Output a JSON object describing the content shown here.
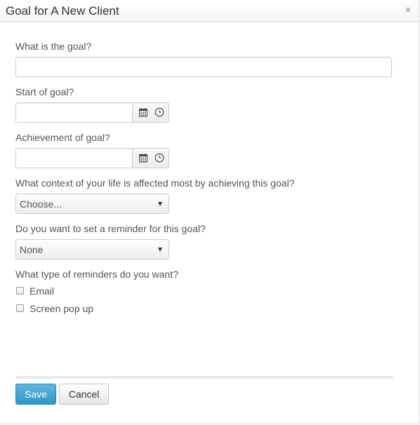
{
  "dialog": {
    "title": "Goal for A New Client"
  },
  "form": {
    "goal_label": "What is the goal?",
    "goal_value": "",
    "start_label": "Start of goal?",
    "start_value": "",
    "achievement_label": "Achievement of goal?",
    "achievement_value": "",
    "context_label": "What context of your life is affected most by achieving this goal?",
    "context_selected": "Choose...",
    "reminder_label": "Do you want to set a reminder for this goal?",
    "reminder_selected": "None",
    "reminder_types_label": "What type of reminders do you want?",
    "reminder_types": [
      {
        "label": "Email",
        "checked": false
      },
      {
        "label": "Screen pop up",
        "checked": false
      }
    ]
  },
  "footer": {
    "save_label": "Save",
    "cancel_label": "Cancel"
  },
  "icons": {
    "close": "close-icon",
    "calendar": "calendar-icon",
    "clock": "clock-icon",
    "dropdown": "chevron-down-icon"
  },
  "colors": {
    "primary_button": "#2f96c8",
    "text": "#555555",
    "border": "#cccccc"
  }
}
